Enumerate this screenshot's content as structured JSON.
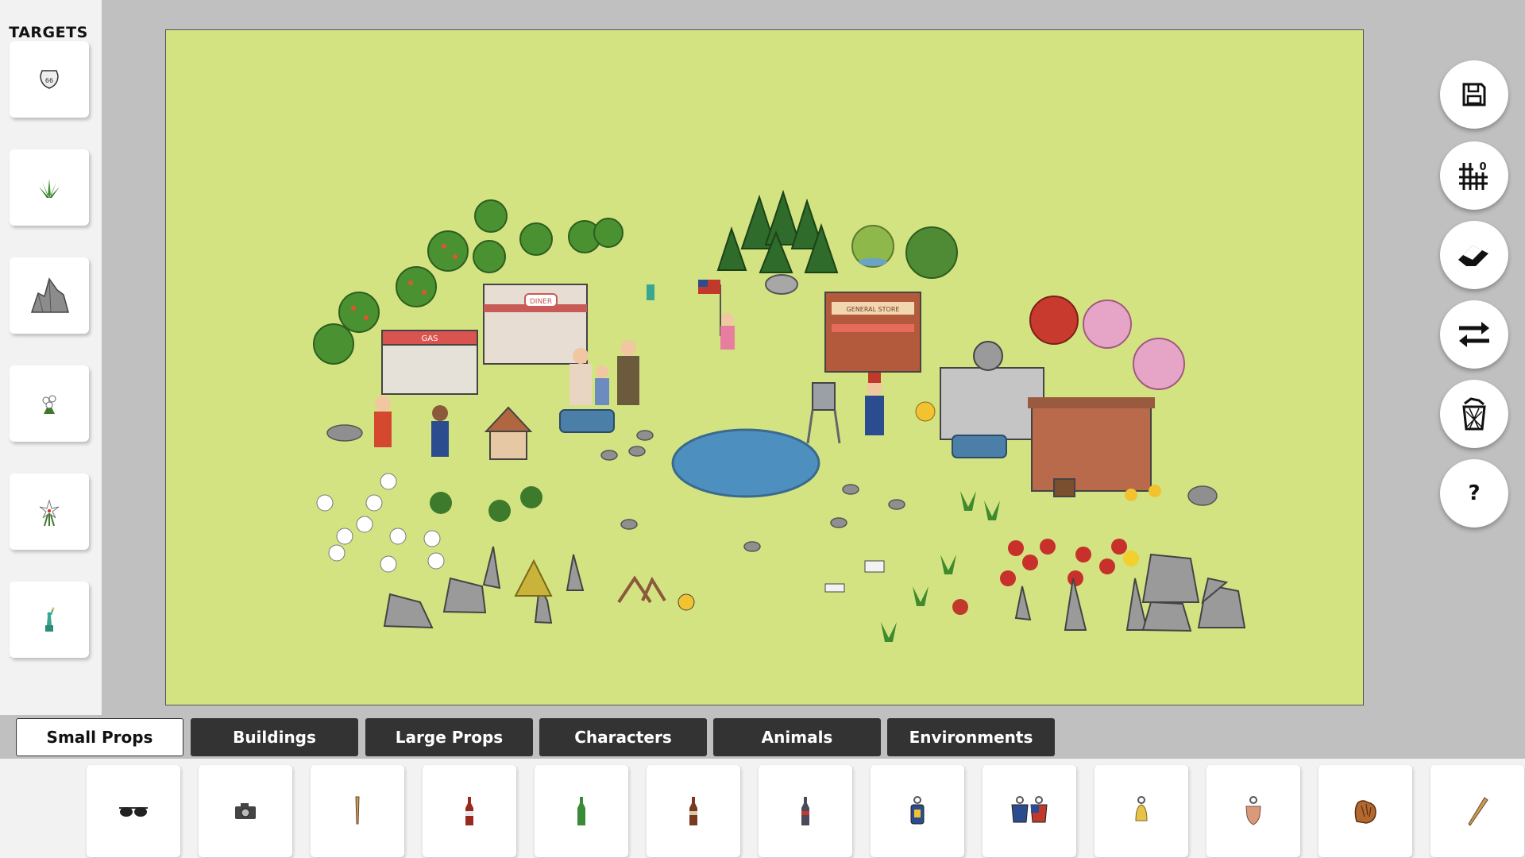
{
  "targets": {
    "title": "TARGETS",
    "items": [
      {
        "icon": "route-shield-icon"
      },
      {
        "icon": "grass-tuft-icon"
      },
      {
        "icon": "rock-icon"
      },
      {
        "icon": "white-flowers-icon"
      },
      {
        "icon": "lily-icon"
      },
      {
        "icon": "statue-of-liberty-icon"
      }
    ]
  },
  "tools": [
    {
      "name": "save-button",
      "icon": "floppy-disk-icon"
    },
    {
      "name": "grid-toggle-button",
      "icon": "grid-icon",
      "badge": "0"
    },
    {
      "name": "eraser-button",
      "icon": "eraser-icon"
    },
    {
      "name": "swap-button",
      "icon": "swap-arrows-icon"
    },
    {
      "name": "delete-button",
      "icon": "trash-icon"
    },
    {
      "name": "help-button",
      "icon": "help-icon",
      "label": "?"
    }
  ],
  "tabs": [
    {
      "label": "Small Props",
      "active": true
    },
    {
      "label": "Buildings",
      "active": false
    },
    {
      "label": "Large Props",
      "active": false
    },
    {
      "label": "Characters",
      "active": false
    },
    {
      "label": "Animals",
      "active": false
    },
    {
      "label": "Environments",
      "active": false
    }
  ],
  "props": [
    {
      "icon": "sunglasses-icon"
    },
    {
      "icon": "camera-icon"
    },
    {
      "icon": "baseball-bat-icon"
    },
    {
      "icon": "cola-bottle-icon"
    },
    {
      "icon": "green-bottle-icon"
    },
    {
      "icon": "brown-bottle-icon"
    },
    {
      "icon": "dark-bottle-icon"
    },
    {
      "icon": "keychain-icon"
    },
    {
      "icon": "keychain-pair-icon"
    },
    {
      "icon": "bell-keychain-icon"
    },
    {
      "icon": "shield-keychain-icon"
    },
    {
      "icon": "baseball-glove-icon"
    },
    {
      "icon": "bat-icon"
    }
  ],
  "scene": {
    "background_color": "#d4e382",
    "building_signs": [
      "DINER",
      "GAS",
      "GENERAL STORE"
    ]
  }
}
